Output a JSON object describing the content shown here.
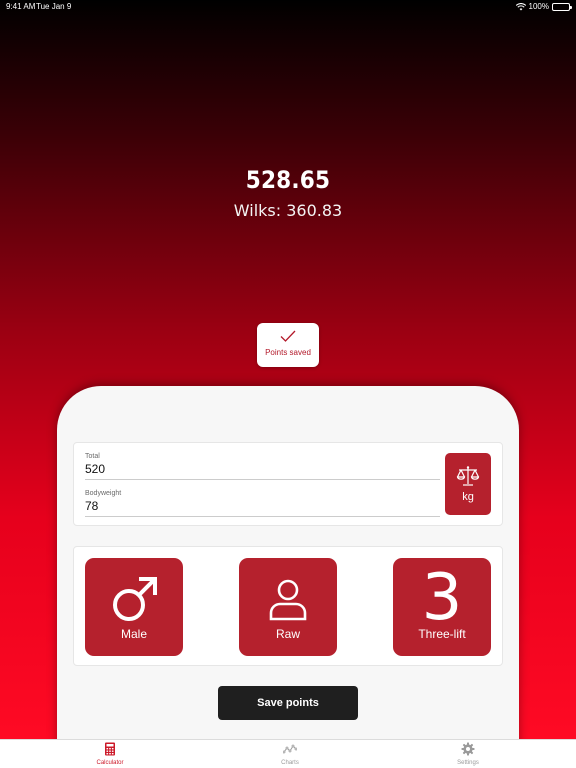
{
  "status_bar": {
    "time": "9:41 AM",
    "date": "Tue Jan 9",
    "battery": "100%",
    "wifi_icon": "wifi-icon",
    "battery_icon": "battery-icon"
  },
  "result": {
    "points": "528.65",
    "wilks": "Wilks: 360.83"
  },
  "toast": {
    "label": "Points saved",
    "icon": "checkmark-icon"
  },
  "inputs": {
    "total": {
      "label": "Total",
      "value": "520"
    },
    "bodyweight": {
      "label": "Bodyweight",
      "value": "78"
    },
    "unit_button": {
      "label": "kg",
      "icon": "scale-icon"
    }
  },
  "options": {
    "sex": {
      "label": "Male",
      "icon": "male-symbol-icon"
    },
    "equipment": {
      "label": "Raw",
      "icon": "person-icon"
    },
    "lift": {
      "label": "Three-lift",
      "glyph": "3"
    }
  },
  "save_button": {
    "label": "Save points"
  },
  "tabs": [
    {
      "label": "Calculator",
      "icon": "calculator-icon",
      "active": true
    },
    {
      "label": "Charts",
      "icon": "chart-line-icon",
      "active": false
    },
    {
      "label": "Settings",
      "icon": "gear-icon",
      "active": false
    }
  ],
  "colors": {
    "accent": "#b5212d",
    "tab_active": "#cc1a2a",
    "save_button": "#1f1f1f",
    "gradient_top": "#000000",
    "gradient_bottom": "#ff0a24"
  }
}
